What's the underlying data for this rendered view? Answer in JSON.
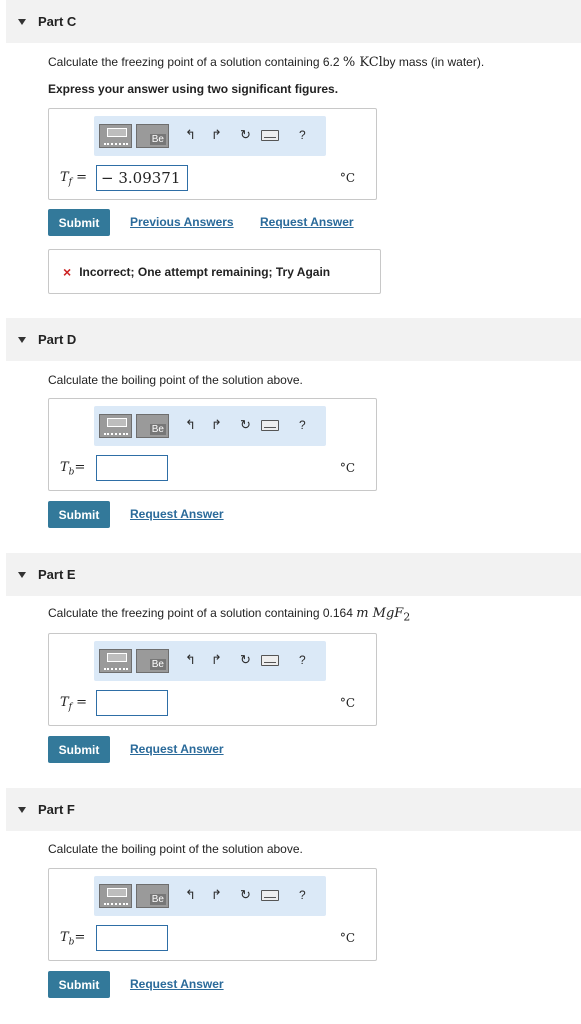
{
  "partC": {
    "header": "Part C",
    "question_prefix": "Calculate the freezing point of a solution containing 6.2 ",
    "question_math": "% KCl",
    "question_suffix": "by mass (in water).",
    "instruction": "Express your answer using two significant figures.",
    "var": "T",
    "var_sub": "f",
    "input_value": "− 3.09371",
    "unit": "°C",
    "submit_label": "Submit",
    "link_previous": "Previous Answers",
    "link_request": "Request Answer",
    "feedback_icon": "×",
    "feedback_text": "Incorrect; One attempt remaining; Try Again"
  },
  "partD": {
    "header": "Part D",
    "question": "Calculate the boiling point of the solution above.",
    "var": "T",
    "var_sub": "b",
    "input_value": "",
    "unit": "°C",
    "submit_label": "Submit",
    "link_request": "Request Answer"
  },
  "partE": {
    "header": "Part E",
    "question_prefix": "Calculate the freezing point of a solution containing 0.164 ",
    "question_math": "m MgF",
    "question_math_sub": "2",
    "var": "T",
    "var_sub": "f",
    "input_value": "",
    "unit": "°C",
    "submit_label": "Submit",
    "link_request": "Request Answer"
  },
  "partF": {
    "header": "Part F",
    "question": "Calculate the boiling point of the solution above.",
    "var": "T",
    "var_sub": "b",
    "input_value": "",
    "unit": "°C",
    "submit_label": "Submit",
    "link_request": "Request Answer"
  },
  "toolbar": {
    "template_label": "Be",
    "help_label": "?",
    "icons": [
      "templates-icon",
      "undo-icon",
      "redo-icon",
      "reset-icon",
      "keyboard-icon",
      "help-icon"
    ]
  },
  "colors": {
    "submit": "#33799a",
    "link": "#2a6a9a",
    "toolbar": "#dbe9f7",
    "input_border": "#2e6ea6",
    "error": "#cc2222"
  }
}
